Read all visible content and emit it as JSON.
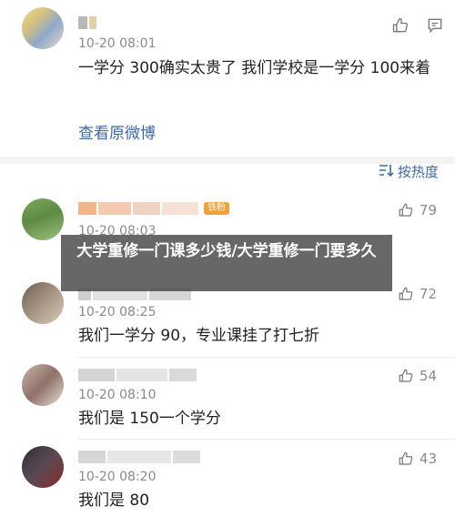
{
  "top_comment": {
    "time": "10-20 08:01",
    "text": "一学分 300确实太贵了 我们学校是一学分 100来着",
    "view_original_label": "查看原微博"
  },
  "sort": {
    "label": "按热度"
  },
  "comments": [
    {
      "time": "10-20 08:03",
      "likes": "79",
      "badge": "铁粉"
    },
    {
      "time": "10-20 08:25",
      "text": "我们一学分 90，专业课挂了打七折",
      "likes": "72"
    },
    {
      "time": "10-20 08:10",
      "text": "我们是 150一个学分",
      "likes": "54"
    },
    {
      "time": "10-20 08:20",
      "text": "我们是 80",
      "likes": "43"
    }
  ],
  "banner": {
    "title": "大学重修一门课多少钱/大学重修一门要多久"
  },
  "colors": {
    "link": "#3b6aa8",
    "meta": "#8a8a8a",
    "banner_bg": "#464646"
  }
}
